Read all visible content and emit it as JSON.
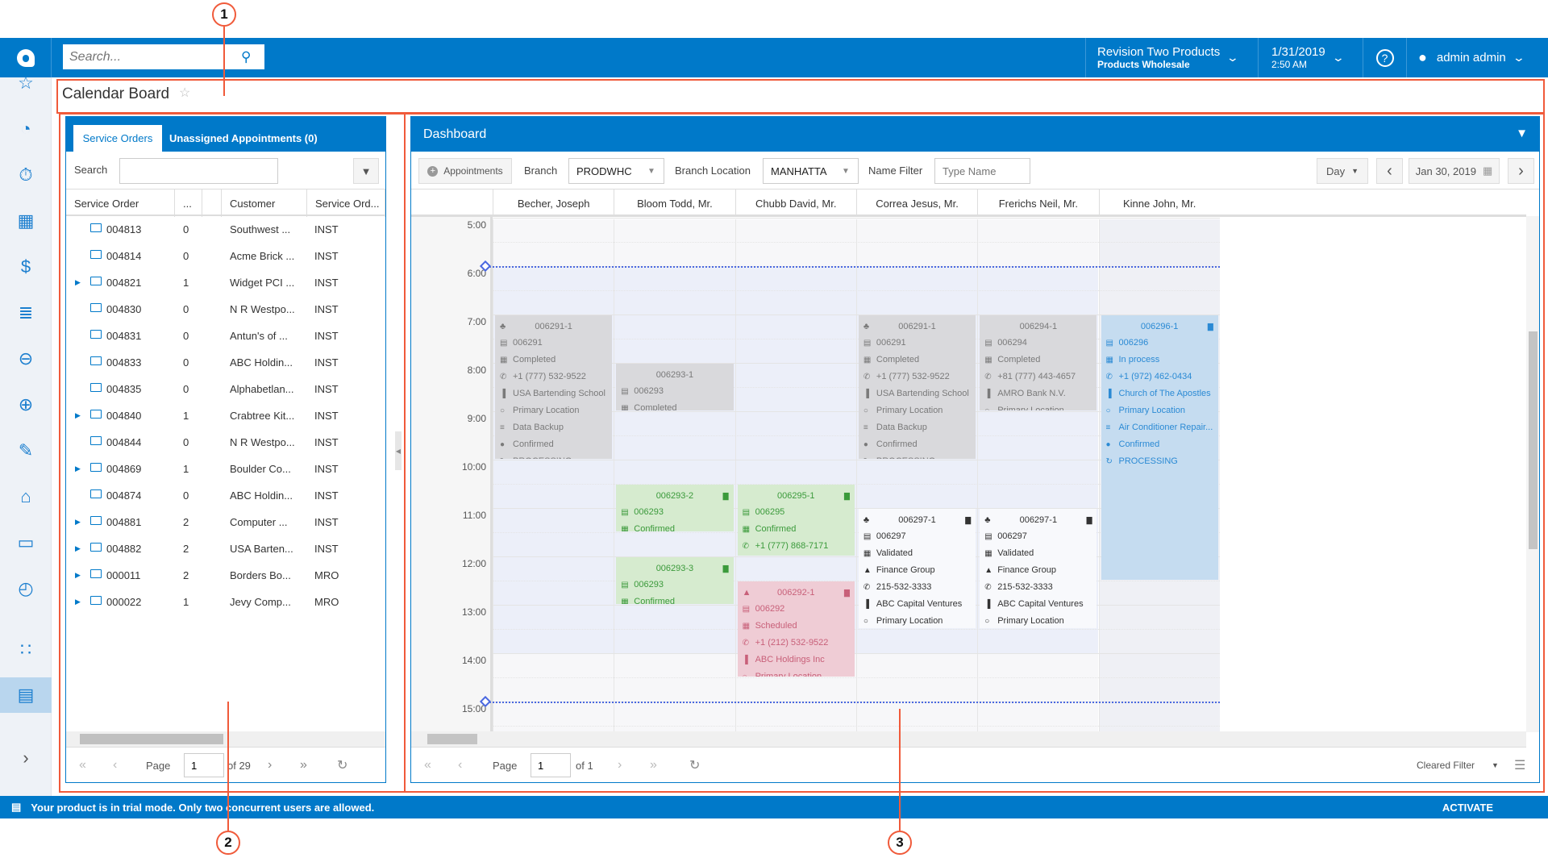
{
  "header": {
    "search_placeholder": "Search...",
    "company": "Revision Two Products",
    "branch": "Products Wholesale",
    "date": "1/31/2019",
    "time": "2:50 AM",
    "user": "admin admin"
  },
  "page": {
    "title": "Calendar Board"
  },
  "sidebar": {
    "icons": [
      "star-icon",
      "pie-chart-icon",
      "stopwatch-icon",
      "calculator-icon",
      "dollar-icon",
      "list-icon",
      "minus-circle-icon",
      "plus-circle-icon",
      "edit-icon",
      "cart-icon",
      "truck-icon",
      "gauge-icon",
      "apps-grid-icon",
      "briefcase-icon",
      "expand-chevron-icon"
    ]
  },
  "left": {
    "tabs": [
      "Service Orders",
      "Unassigned Appointments (0)"
    ],
    "search_label": "Search",
    "search_value": "",
    "columns": [
      "Service Order",
      "...",
      "",
      "Customer",
      "Service Ord..."
    ],
    "rows": [
      {
        "expand": false,
        "order": "004813",
        "count": "0",
        "customer": "Southwest ...",
        "type": "INST"
      },
      {
        "expand": false,
        "order": "004814",
        "count": "0",
        "customer": "Acme Brick ...",
        "type": "INST"
      },
      {
        "expand": true,
        "order": "004821",
        "count": "1",
        "customer": "Widget PCI ...",
        "type": "INST"
      },
      {
        "expand": false,
        "order": "004830",
        "count": "0",
        "customer": "N R Westpo...",
        "type": "INST"
      },
      {
        "expand": false,
        "order": "004831",
        "count": "0",
        "customer": "Antun's of ...",
        "type": "INST"
      },
      {
        "expand": false,
        "order": "004833",
        "count": "0",
        "customer": "ABC Holdin...",
        "type": "INST"
      },
      {
        "expand": false,
        "order": "004835",
        "count": "0",
        "customer": "Alphabetlan...",
        "type": "INST"
      },
      {
        "expand": true,
        "order": "004840",
        "count": "1",
        "customer": "Crabtree Kit...",
        "type": "INST"
      },
      {
        "expand": false,
        "order": "004844",
        "count": "0",
        "customer": "N R Westpo...",
        "type": "INST"
      },
      {
        "expand": true,
        "order": "004869",
        "count": "1",
        "customer": "Boulder Co...",
        "type": "INST"
      },
      {
        "expand": false,
        "order": "004874",
        "count": "0",
        "customer": "ABC Holdin...",
        "type": "INST"
      },
      {
        "expand": true,
        "order": "004881",
        "count": "2",
        "customer": "Computer ...",
        "type": "INST"
      },
      {
        "expand": true,
        "order": "004882",
        "count": "2",
        "customer": "USA Barten...",
        "type": "INST"
      },
      {
        "expand": true,
        "order": "000011",
        "count": "2",
        "customer": "Borders Bo...",
        "type": "MRO"
      },
      {
        "expand": true,
        "order": "000022",
        "count": "1",
        "customer": "Jevy Comp...",
        "type": "MRO"
      }
    ],
    "pager": {
      "page_label": "Page",
      "page": "1",
      "of": "of 29"
    }
  },
  "dashboard": {
    "title": "Dashboard",
    "appointments_button": "Appointments",
    "branch_label": "Branch",
    "branch_value": "PRODWHC",
    "location_label": "Branch Location",
    "location_value": "MANHATTA",
    "name_filter_label": "Name Filter",
    "name_placeholder": "Type Name",
    "view": "Day",
    "date": "Jan 30, 2019",
    "staff": [
      "Becher, Joseph",
      "Bloom Todd, Mr.",
      "Chubb David, Mr.",
      "Correa Jesus, Mr.",
      "Frerichs Neil, Mr.",
      "Kinne John, Mr."
    ],
    "hours": [
      "5:00",
      "6:00",
      "7:00",
      "8:00",
      "9:00",
      "10:00",
      "11:00",
      "12:00",
      "13:00",
      "14:00",
      "15:00"
    ],
    "cards": [
      {
        "col": 0,
        "start": 7,
        "end": 10,
        "style": "gray",
        "title": "006291-1",
        "lead": "group",
        "del": false,
        "lines": [
          [
            "doc",
            "006291"
          ],
          [
            "cal",
            "Completed"
          ],
          [
            "phone",
            "+1 (777) 532-9522"
          ],
          [
            "bldg",
            "USA Bartending School"
          ],
          [
            "pin",
            "Primary Location"
          ],
          [
            "list",
            "Data Backup"
          ],
          [
            "check",
            "Confirmed"
          ],
          [
            "sync",
            "PROCESSING"
          ]
        ]
      },
      {
        "col": 1,
        "start": 8,
        "end": 9,
        "style": "gray",
        "title": "006293-1",
        "lead": "",
        "del": false,
        "lines": [
          [
            "doc",
            "006293"
          ],
          [
            "cal",
            "Completed"
          ]
        ]
      },
      {
        "col": 1,
        "start": 10.5,
        "end": 11.5,
        "style": "green",
        "title": "006293-2",
        "lead": "",
        "del": true,
        "lines": [
          [
            "doc",
            "006293"
          ],
          [
            "cal",
            "Confirmed"
          ]
        ]
      },
      {
        "col": 1,
        "start": 12,
        "end": 13,
        "style": "green",
        "title": "006293-3",
        "lead": "",
        "del": true,
        "lines": [
          [
            "doc",
            "006293"
          ],
          [
            "cal",
            "Confirmed"
          ]
        ]
      },
      {
        "col": 2,
        "start": 10.5,
        "end": 12,
        "style": "green",
        "title": "006295-1",
        "lead": "",
        "del": true,
        "lines": [
          [
            "doc",
            "006295"
          ],
          [
            "cal",
            "Confirmed"
          ],
          [
            "phone",
            "+1 (777) 868-7171"
          ]
        ]
      },
      {
        "col": 2,
        "start": 12.5,
        "end": 14.5,
        "style": "pink",
        "title": "006292-1",
        "lead": "warn",
        "del": true,
        "lines": [
          [
            "doc",
            "006292"
          ],
          [
            "cal",
            "Scheduled"
          ],
          [
            "phone",
            "+1 (212) 532-9522"
          ],
          [
            "bldg",
            "ABC Holdings Inc"
          ],
          [
            "pin",
            "Primary Location"
          ]
        ]
      },
      {
        "col": 3,
        "start": 7,
        "end": 10,
        "style": "gray",
        "title": "006291-1",
        "lead": "group",
        "del": false,
        "lines": [
          [
            "doc",
            "006291"
          ],
          [
            "cal",
            "Completed"
          ],
          [
            "phone",
            "+1 (777) 532-9522"
          ],
          [
            "bldg",
            "USA Bartending School"
          ],
          [
            "pin",
            "Primary Location"
          ],
          [
            "list",
            "Data Backup"
          ],
          [
            "check",
            "Confirmed"
          ],
          [
            "sync",
            "PROCESSING"
          ]
        ]
      },
      {
        "col": 3,
        "start": 11,
        "end": 13.5,
        "style": "white",
        "title": "006297-1",
        "lead": "group",
        "del": true,
        "lines": [
          [
            "doc",
            "006297"
          ],
          [
            "cal",
            "Validated"
          ],
          [
            "user",
            "Finance Group"
          ],
          [
            "phone",
            "215-532-3333"
          ],
          [
            "bldg",
            "ABC Capital Ventures"
          ],
          [
            "pin",
            "Primary Location"
          ]
        ]
      },
      {
        "col": 4,
        "start": 7,
        "end": 9,
        "style": "gray",
        "title": "006294-1",
        "lead": "",
        "del": false,
        "lines": [
          [
            "doc",
            "006294"
          ],
          [
            "cal",
            "Completed"
          ],
          [
            "phone",
            "+81 (777) 443-4657"
          ],
          [
            "bldg",
            "AMRO Bank N.V."
          ],
          [
            "pin",
            "Primary Location"
          ]
        ]
      },
      {
        "col": 4,
        "start": 11,
        "end": 13.5,
        "style": "white",
        "title": "006297-1",
        "lead": "group",
        "del": true,
        "lines": [
          [
            "doc",
            "006297"
          ],
          [
            "cal",
            "Validated"
          ],
          [
            "user",
            "Finance Group"
          ],
          [
            "phone",
            "215-532-3333"
          ],
          [
            "bldg",
            "ABC Capital Ventures"
          ],
          [
            "pin",
            "Primary Location"
          ]
        ]
      },
      {
        "col": 5,
        "start": 7,
        "end": 12.5,
        "style": "blue",
        "title": "006296-1",
        "lead": "",
        "del": true,
        "lines": [
          [
            "doc",
            "006296"
          ],
          [
            "cal",
            "In process"
          ],
          [
            "phone",
            "+1 (972) 462-0434"
          ],
          [
            "bldg",
            "Church of The Apostles"
          ],
          [
            "pin",
            "Primary Location"
          ],
          [
            "list",
            "Air Conditioner Repair..."
          ],
          [
            "check",
            "Confirmed"
          ],
          [
            "sync",
            "PROCESSING"
          ]
        ]
      }
    ],
    "pager": {
      "page_label": "Page",
      "page": "1",
      "of": "of 1"
    },
    "cleared_filter": "Cleared Filter"
  },
  "status": {
    "message": "Your product is in trial mode. Only two concurrent users are allowed.",
    "activate": "ACTIVATE"
  },
  "annotations": [
    "1",
    "2",
    "3"
  ],
  "colors": {
    "brand": "#0079c9",
    "annotation": "#f05a3a"
  }
}
